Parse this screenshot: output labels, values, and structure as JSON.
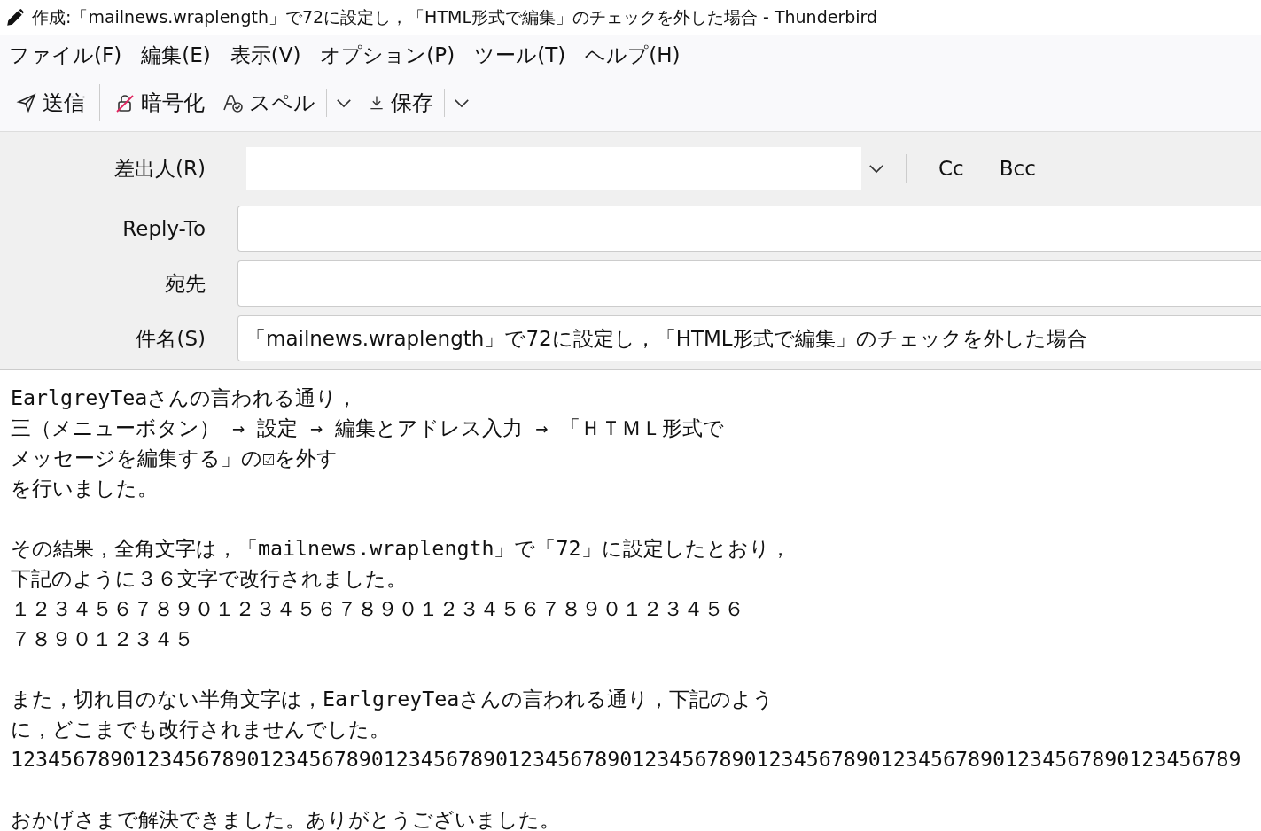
{
  "window": {
    "title": "作成:「mailnews.wraplength」で72に設定し，「HTML形式で編集」のチェックを外した場合 - Thunderbird"
  },
  "menu": [
    "ファイル(F)",
    "編集(E)",
    "表示(V)",
    "オプション(P)",
    "ツール(T)",
    "ヘルプ(H)"
  ],
  "toolbar": [
    {
      "kind": "send",
      "label": "送信"
    },
    {
      "kind": "encrypt",
      "label": "暗号化"
    },
    {
      "kind": "spell",
      "label": "スペル",
      "dropdown": true
    },
    {
      "kind": "save",
      "label": "保存",
      "dropdown": true
    }
  ],
  "header": {
    "from_label": "差出人(R)",
    "cc": "Cc",
    "bcc": "Bcc",
    "fields": [
      {
        "label": "Reply-To"
      },
      {
        "label": "宛先"
      },
      {
        "label": "件名(S)",
        "value": "「mailnews.wraplength」で72に設定し，「HTML形式で編集」のチェックを外した場合"
      }
    ]
  },
  "body": {
    "paragraphs": [
      [
        "EarlgreyTeaさんの言われる通り，",
        "三（メニューボタン） → 設定 → 編集とアドレス入力 → 「ＨＴＭＬ形式で",
        "メッセージを編集する」の☑を外す",
        "を行いました。"
      ],
      [
        "その結果，全角文字は，「mailnews.wraplength」で「72」に設定したとおり，",
        "下記のように３６文字で改行されました。",
        "１２３４５６７８９０１２３４５６７８９０１２３４５６７８９０１２３４５６",
        "７８９０１２３４５"
      ],
      [
        "また，切れ目のない半角文字は，EarlgreyTeaさんの言われる通り，下記のよう",
        "に，どこまでも改行されませんでした。",
        "123456789012345678901234567890123456789012345678901234567890123456789012345678901234567890123456789"
      ],
      [
        "おかげさまで解決できました。ありがとうございました。"
      ]
    ]
  }
}
